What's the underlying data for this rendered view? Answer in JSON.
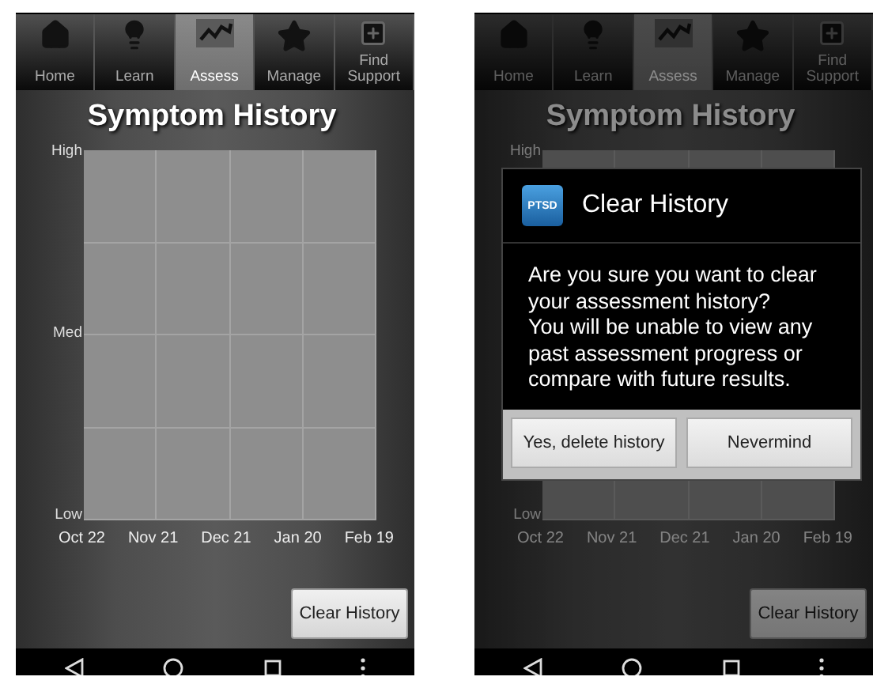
{
  "screens": [
    {
      "tabs": [
        {
          "label": "Home",
          "selected": false
        },
        {
          "label": "Learn",
          "selected": false
        },
        {
          "label": "Assess",
          "selected": true
        },
        {
          "label": "Manage",
          "selected": false
        },
        {
          "label": "Find Support",
          "selected": false
        }
      ],
      "title": "Symptom History",
      "chart": {
        "y_labels": [
          "High",
          "Med",
          "Low"
        ],
        "x_labels": [
          "Oct 22",
          "Nov 21",
          "Dec 21",
          "Jan 20",
          "Feb 19"
        ]
      },
      "clear_button": "Clear History",
      "dimmed": false
    },
    {
      "tabs": [
        {
          "label": "Home",
          "selected": false
        },
        {
          "label": "Learn",
          "selected": false
        },
        {
          "label": "Assess",
          "selected": true
        },
        {
          "label": "Manage",
          "selected": false
        },
        {
          "label": "Find Support",
          "selected": false
        }
      ],
      "title": "Symptom History",
      "chart": {
        "y_labels": [
          "High",
          "Low"
        ],
        "x_labels": [
          "Oct 22",
          "Nov 21",
          "Dec 21",
          "Jan 20",
          "Feb 19"
        ]
      },
      "clear_button": "Clear History",
      "dimmed": true,
      "dialog": {
        "icon_label": "PTSD",
        "title": "Clear History",
        "message": [
          "Are you sure you want to clear your assessment history?",
          "You will be unable to view any past assessment progress or compare with future results."
        ],
        "buttons": [
          "Yes, delete history",
          "Nevermind"
        ]
      }
    }
  ]
}
